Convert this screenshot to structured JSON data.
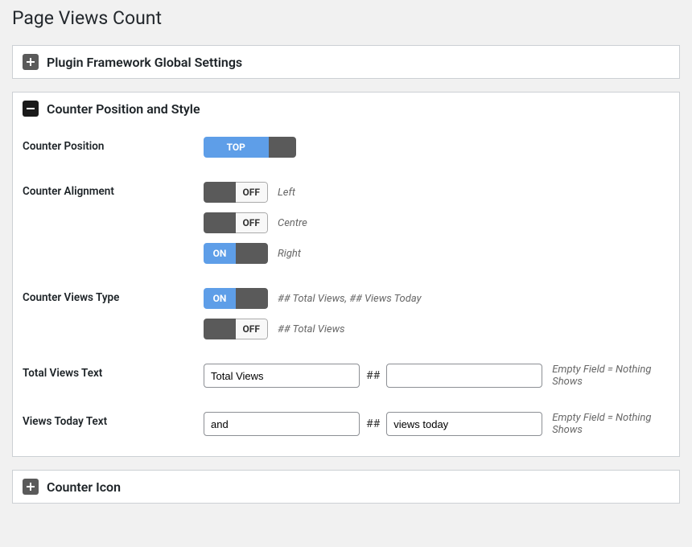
{
  "page": {
    "title": "Page Views Count"
  },
  "panels": {
    "global": {
      "title": "Plugin Framework Global Settings"
    },
    "counter": {
      "title": "Counter Position and Style",
      "position": {
        "label": "Counter Position",
        "top_label": "TOP"
      },
      "alignment": {
        "label": "Counter Alignment",
        "on": "ON",
        "off": "OFF",
        "left": "Left",
        "centre": "Centre",
        "right": "Right"
      },
      "views_type": {
        "label": "Counter Views Type",
        "on": "ON",
        "off": "OFF",
        "opt1": "## Total Views, ## Views Today",
        "opt2": "## Total Views"
      },
      "total_views": {
        "label": "Total Views Text",
        "value1": "Total Views",
        "value2": "",
        "sep": "##",
        "hint": "Empty Field = Nothing Shows"
      },
      "views_today": {
        "label": "Views Today Text",
        "value1": "and",
        "value2": "views today",
        "sep": "##",
        "hint": "Empty Field = Nothing Shows"
      }
    },
    "icon": {
      "title": "Counter Icon"
    }
  }
}
